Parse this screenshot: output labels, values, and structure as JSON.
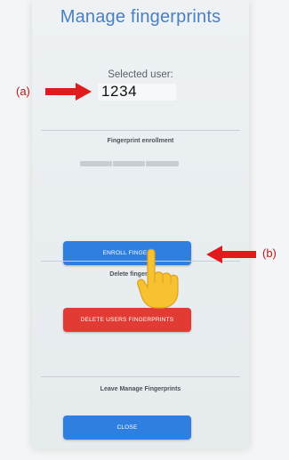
{
  "title": "Manage fingerprints",
  "selected_user": {
    "label": "Selected user:",
    "value": "1234"
  },
  "enrollment": {
    "label": "Fingerprint enrollment",
    "progress": 0
  },
  "enroll_button": {
    "label": "ENROLL FINGER"
  },
  "delete_section": {
    "label": "Delete fingerpr",
    "button_label": "DELETE USERS FINGERPRINTS"
  },
  "leave_section": {
    "label": "Leave Manage Fingerprints",
    "button_label": "CLOSE"
  },
  "annotations": {
    "a": "(a)",
    "b": "(b)"
  },
  "colors": {
    "title": "#4a7fc1",
    "primary_button": "#2f7fe0",
    "danger_button": "#e23b34",
    "annotation_arrow": "#e01b1b",
    "hand": "#f7c231"
  }
}
